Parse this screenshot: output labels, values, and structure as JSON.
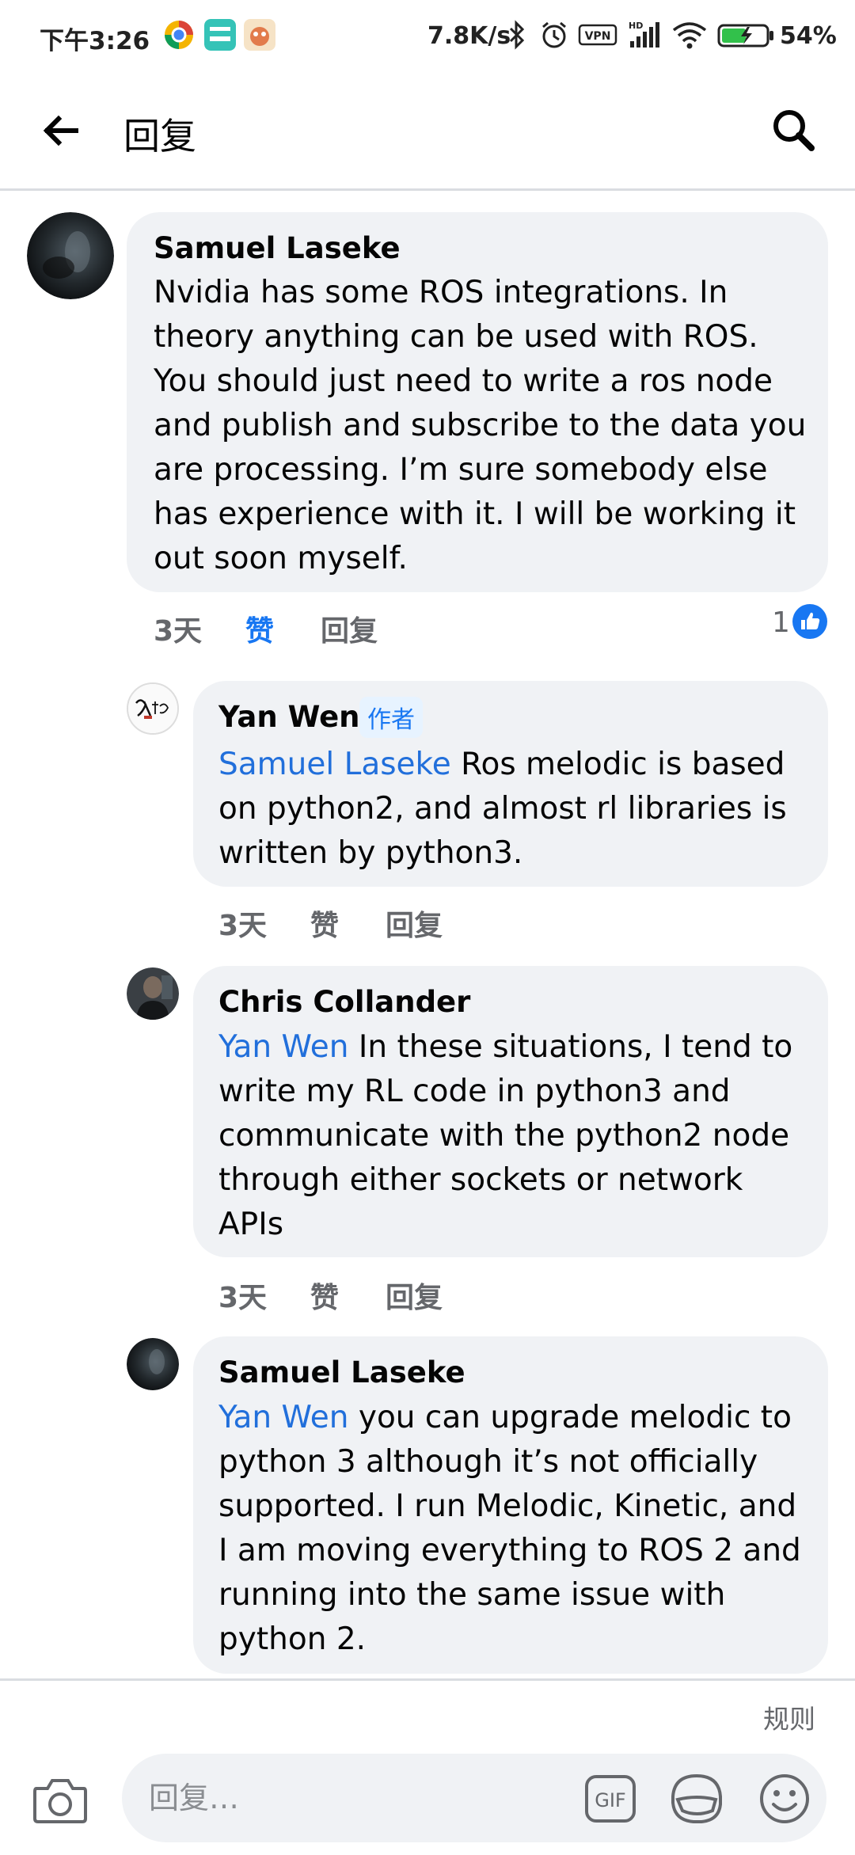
{
  "status_bar": {
    "time": "下午3:26",
    "network_speed": "7.8K/s",
    "battery": "54%"
  },
  "header": {
    "title": "回复"
  },
  "comments": [
    {
      "author": "Samuel Laseke",
      "text": "Nvidia has some ROS integrations. In theory anything can be used with ROS. You should just need to write a ros node and publish and subscribe to the data you are processing. I’m sure somebody else has experience with it. I will be working it out soon myself.",
      "time": "3天",
      "like_label": "赞",
      "reply_label": "回复",
      "like_count": "1"
    },
    {
      "author": "Yan Wen",
      "badge": "作者",
      "mention": "Samuel Laseke",
      "text": " Ros melodic is based on python2, and almost rl libraries is written by python3.",
      "time": "3天",
      "like_label": "赞",
      "reply_label": "回复"
    },
    {
      "author": "Chris Collander",
      "mention": "Yan Wen",
      "text": " In these situations, I tend to write my RL code in python3 and communicate with the python2 node through either sockets or network APIs",
      "time": "3天",
      "like_label": "赞",
      "reply_label": "回复"
    },
    {
      "author": "Samuel Laseke",
      "mention": "Yan Wen",
      "text": " you can upgrade melodic to python 3 although it’s not officially supported. I run Melodic, Kinetic, and I am moving everything to ROS 2 and running into the same issue with python 2."
    }
  ],
  "composer": {
    "rules_label": "规则",
    "placeholder": "回复…",
    "gif_label": "GIF"
  },
  "colors": {
    "mention": "#216fdb",
    "like_active": "#1877f2",
    "bubble_bg": "#f0f2f5"
  },
  "icons": [
    "back-arrow-icon",
    "search-icon",
    "thumbs-up-icon",
    "camera-icon",
    "gif-icon",
    "sticker-icon",
    "emoji-icon"
  ]
}
